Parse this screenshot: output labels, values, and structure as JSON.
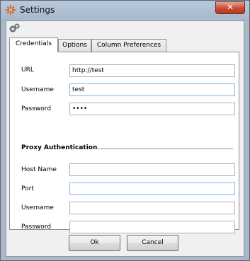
{
  "window": {
    "title": "Settings",
    "close_glyph": "✕",
    "icon": "settings-app-icon"
  },
  "toolbar": {
    "icon": "gear-icon"
  },
  "tabs": [
    {
      "label": "Credentials",
      "active": true
    },
    {
      "label": "Options",
      "active": false
    },
    {
      "label": "Column Preferences",
      "active": false
    }
  ],
  "credentials": {
    "url_label": "URL",
    "url_value": "http://test",
    "username_label": "Username",
    "username_value": "test",
    "password_label": "Password",
    "password_value": "••••"
  },
  "proxy": {
    "section_title": "Proxy Authentication",
    "host_label": "Host Name",
    "host_value": "",
    "port_label": "Port",
    "port_value": "",
    "username_label": "Username",
    "username_value": "",
    "password_label": "Password",
    "password_value": ""
  },
  "buttons": {
    "ok": "Ok",
    "cancel": "Cancel"
  }
}
